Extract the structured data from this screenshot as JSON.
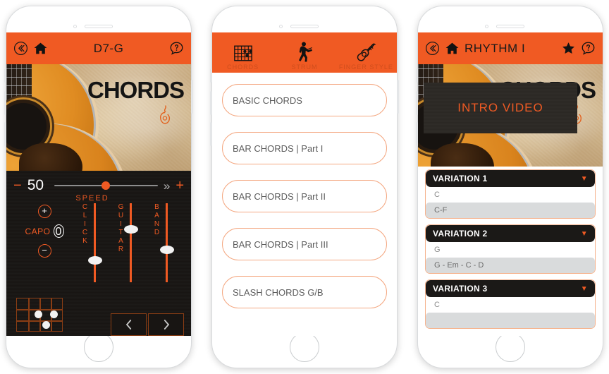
{
  "brand": {
    "orange": "#f05a23",
    "dark": "#181513",
    "pill_border": "#f4a882"
  },
  "phone1": {
    "header": {
      "back_icon": "chevrons-left-circle-icon",
      "home_icon": "home-icon",
      "title": "D7-G",
      "help_icon": "help-chat-icon"
    },
    "hero": {
      "word": "CHORDS",
      "logo_icon": "guitar-flame-logo-icon"
    },
    "controls": {
      "minus_label": "−",
      "speed_value": "50",
      "speed_label": "SPEED",
      "fast_forward_icon": "double-chevron-right-icon",
      "plus_label": "+",
      "capo_increment_label": "+",
      "capo_label": "CAPO",
      "capo_value": "0",
      "capo_decrement_label": "−",
      "sliders": [
        {
          "label": "CLICK",
          "value_pct": 22
        },
        {
          "label": "GUITAR",
          "value_pct": 62
        },
        {
          "label": "BAND",
          "value_pct": 36
        }
      ],
      "chord_diagram_name": "chord-fretboard-diagram",
      "prev_icon": "chevron-left-icon",
      "next_icon": "chevron-right-icon"
    }
  },
  "phone2": {
    "tabs": [
      {
        "label": "CHORDS",
        "icon": "fretboard-icon",
        "active": true
      },
      {
        "label": "STRUM",
        "icon": "guitarist-silhouette-icon",
        "active": false
      },
      {
        "label": "FINGER STYLE",
        "icon": "acoustic-guitar-icon",
        "active": false
      }
    ],
    "list": [
      "BASIC CHORDS",
      "BAR CHORDS | Part I",
      "BAR CHORDS | Part II",
      "BAR CHORDS | Part III",
      "SLASH CHORDS G/B"
    ]
  },
  "phone3": {
    "header": {
      "back_icon": "chevrons-left-circle-icon",
      "home_icon": "home-icon",
      "title": "RHYTHM I",
      "star_icon": "star-icon",
      "help_icon": "help-chat-icon"
    },
    "hero": {
      "word": "CHORDS",
      "video_label": "INTRO VIDEO"
    },
    "variations": [
      {
        "title": "VARIATION 1",
        "caret": "▼",
        "items": [
          {
            "text": "C",
            "selected": false
          },
          {
            "text": "C-F",
            "selected": true
          }
        ]
      },
      {
        "title": "VARIATION 2",
        "caret": "▼",
        "items": [
          {
            "text": "G",
            "selected": false
          },
          {
            "text": "G - Em - C - D",
            "selected": true
          }
        ]
      },
      {
        "title": "VARIATION 3",
        "caret": "▼",
        "items": [
          {
            "text": "C",
            "selected": false
          }
        ]
      }
    ]
  }
}
